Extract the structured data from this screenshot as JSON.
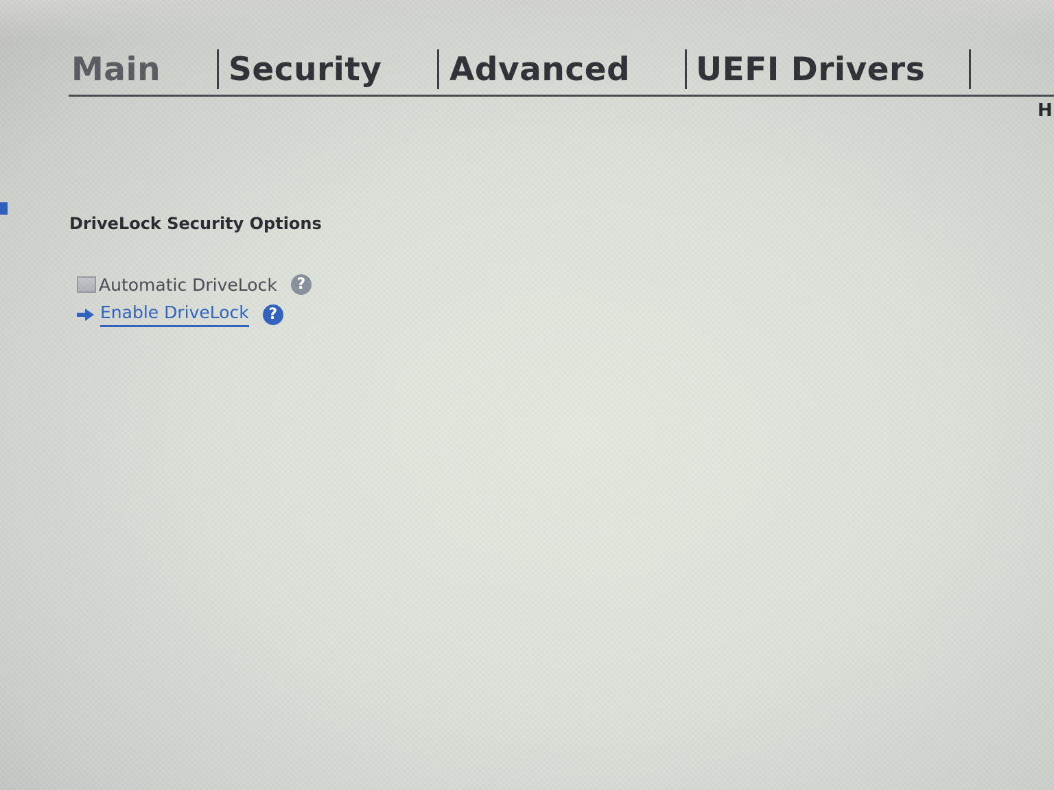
{
  "tabs": {
    "main": "Main",
    "security": "Security",
    "advanced": "Advanced",
    "uefi_drivers": "UEFI Drivers"
  },
  "corner_text": "HI",
  "section": {
    "title": "DriveLock Security Options"
  },
  "options": {
    "automatic_drivelock": {
      "label": "Automatic DriveLock",
      "checked": false,
      "help_icon": "question-mark-icon"
    },
    "enable_drivelock": {
      "label": "Enable DriveLock",
      "icon": "arrow-right-icon",
      "help_icon": "question-mark-icon"
    }
  },
  "help_glyph": "?",
  "colors": {
    "accent": "#1f55b8",
    "text": "#1e1f24",
    "help_gray": "#7f8792"
  }
}
